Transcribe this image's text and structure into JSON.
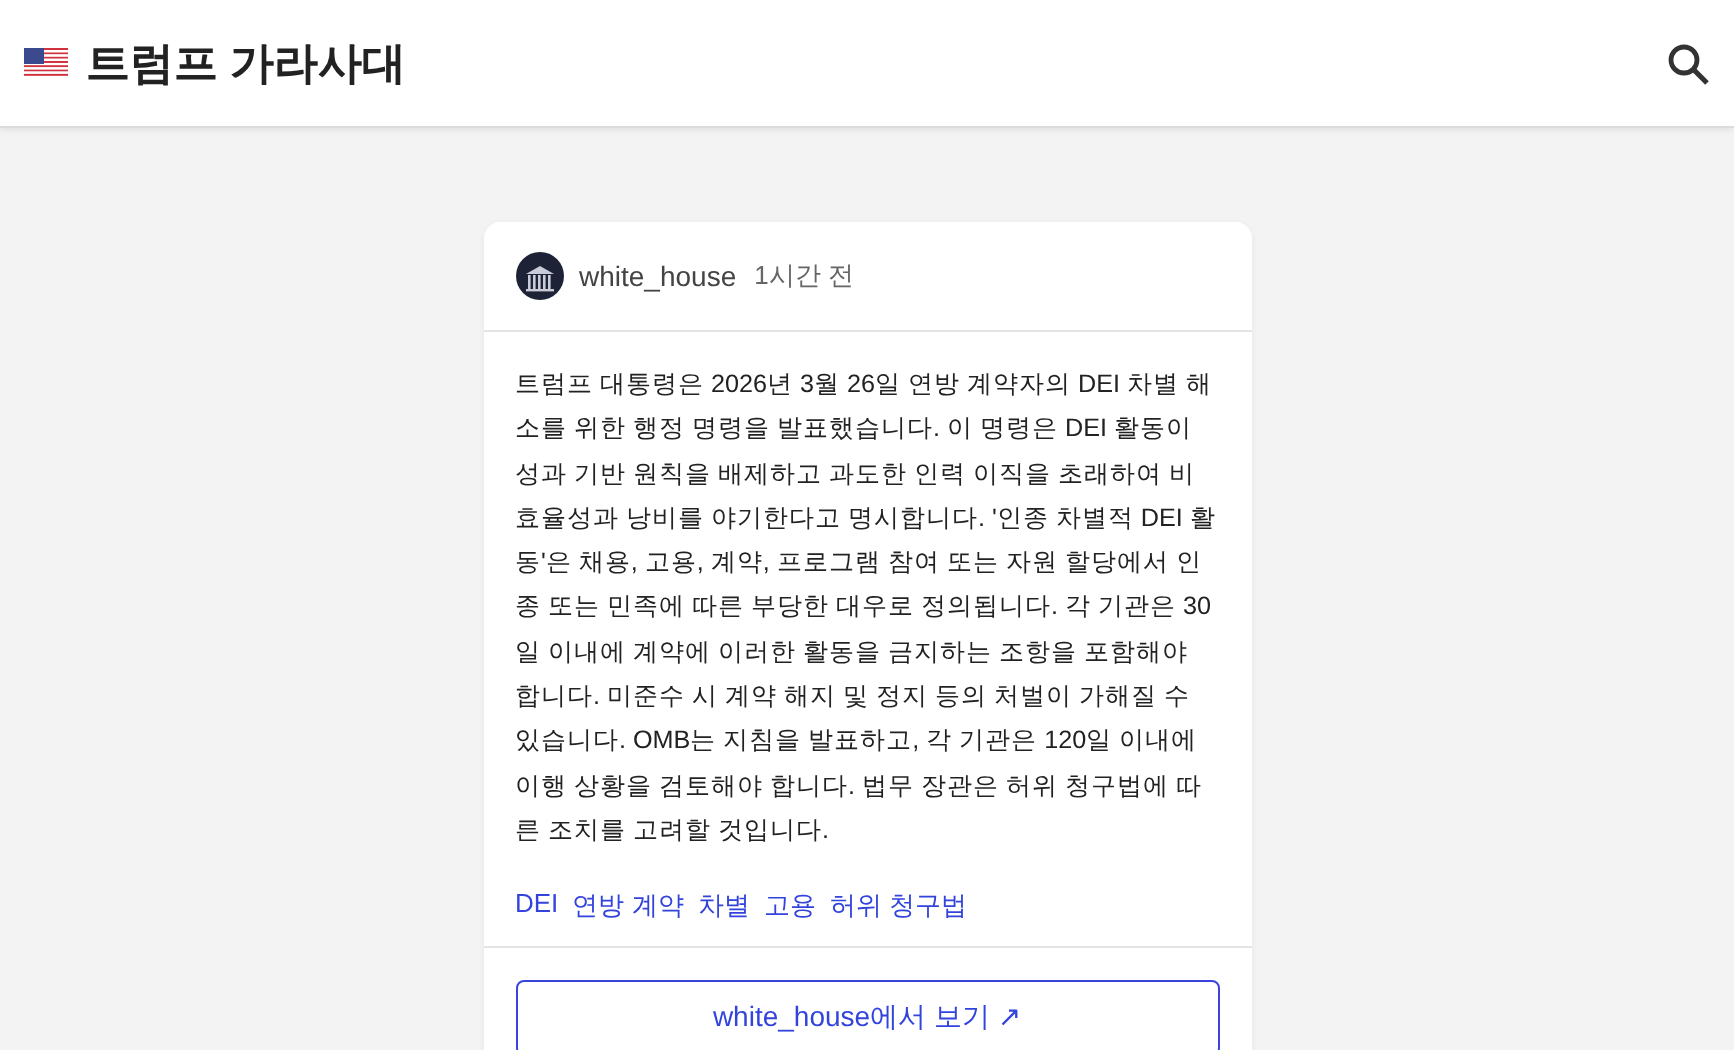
{
  "header": {
    "title": "트럼프 가라사대"
  },
  "post": {
    "author": "white_house",
    "time": "1시간 전",
    "body": "트럼프 대통령은 2026년 3월 26일 연방 계약자의 DEI 차별 해소를 위한 행정 명령을 발표했습니다. 이 명령은 DEI 활동이 성과 기반 원칙을 배제하고 과도한 인력 이직을 초래하여 비효율성과 낭비를 야기한다고 명시합니다. '인종 차별적 DEI 활동'은 채용, 고용, 계약, 프로그램 참여 또는 자원 할당에서 인종 또는 민족에 따른 부당한 대우로 정의됩니다. 각 기관은 30일 이내에 계약에 이러한 활동을 금지하는 조항을 포함해야 합니다. 미준수 시 계약 해지 및 정지 등의 처벌이 가해질 수 있습니다. OMB는 지침을 발표하고, 각 기관은 120일 이내에 이행 상황을 검토해야 합니다. 법무 장관은 허위 청구법에 따른 조치를 고려할 것입니다.",
    "tags": [
      "DEI",
      "연방 계약",
      "차별",
      "고용",
      "허위 청구법"
    ],
    "link": "white_house에서 보기 ↗"
  }
}
